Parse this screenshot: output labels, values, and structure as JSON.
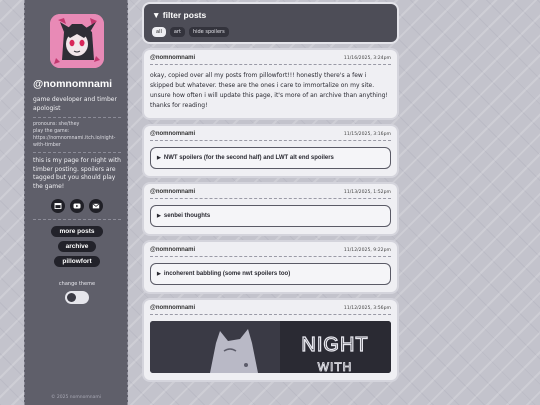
{
  "sidebar": {
    "handle": "@nomnomnami",
    "bio": "game developer and timber apologist",
    "meta_lines": [
      "pronouns: she/they",
      "play the game:",
      "https://nomnomnami.itch.io/night-with-timber"
    ],
    "about": "this is my page for night with timber posting. spoilers are tagged but you should play the game!",
    "icons": [
      "home-icon",
      "youtube-icon",
      "mail-icon"
    ],
    "links": [
      "more posts",
      "archive",
      "pillowfort"
    ],
    "theme_label": "change theme",
    "copyright": "© 2025 nomnomnami"
  },
  "filter": {
    "title": "▼ filter posts",
    "chips": [
      "all",
      "art",
      "hide spoilers"
    ],
    "active_chip": "all"
  },
  "posts": [
    {
      "author": "@nomnomnami",
      "date": "11/16/2025, 3:24pm",
      "body": "okay, copied over all my posts from pillowfort!!! honestly there's a few i skipped but whatever. these are the ones i care to immortalize on my site. unsure how often i will update this page, it's more of an archive than anything! thanks for reading!"
    },
    {
      "author": "@nomnomnami",
      "date": "11/15/2025, 3:16pm",
      "summary": "NWT spoilers (for the second half) and LWT alt end spoilers"
    },
    {
      "author": "@nomnomnami",
      "date": "11/13/2025, 1:52pm",
      "summary": "senbei thoughts"
    },
    {
      "author": "@nomnomnami",
      "date": "11/12/2025, 9:22pm",
      "summary": "incoherent babbling (some nwt spoilers too)"
    },
    {
      "author": "@nomnomnami",
      "date": "11/12/2025, 3:56pm",
      "image_text": "NIGHT WITH"
    }
  ]
}
